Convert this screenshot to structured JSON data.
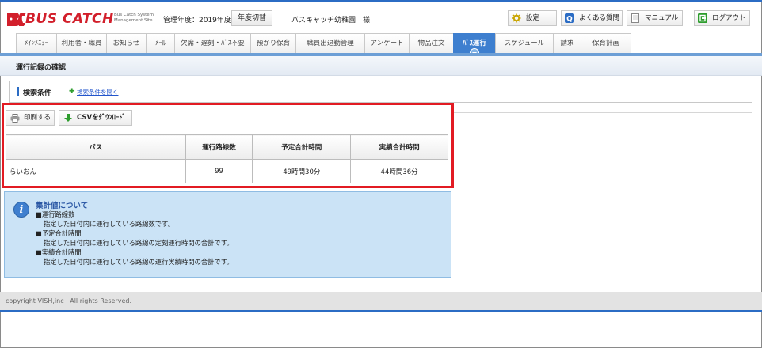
{
  "header": {
    "logo_text": "BUS CATCH",
    "logo_subtitle_1": "Bus Catch System",
    "logo_subtitle_2": "Management Site",
    "fiscal_year": "管理年度：2019年度",
    "year_switch_label": "年度切替",
    "organization": "バスキャッチ幼稚園　様",
    "buttons": {
      "settings": "設定",
      "faq": "よくある質問",
      "manual": "マニュアル",
      "logout": "ログアウト"
    }
  },
  "nav": {
    "tabs": [
      {
        "label": "ﾒｲﾝﾒﾆｭｰ"
      },
      {
        "label": "利用者・職員"
      },
      {
        "label": "お知らせ"
      },
      {
        "label": "ﾒｰﾙ"
      },
      {
        "label": "欠席・遅刻・ﾊﾞｽ不要"
      },
      {
        "label": "預かり保育"
      },
      {
        "label": "職員出退勤管理"
      },
      {
        "label": "アンケート"
      },
      {
        "label": "物品注文"
      },
      {
        "label": "ﾊﾞｽ運行"
      },
      {
        "label": "スケジュール"
      },
      {
        "label": "請求"
      },
      {
        "label": "保育計画"
      }
    ],
    "active_tab": "ﾊﾞｽ運行"
  },
  "page": {
    "title": "運行記録の確認",
    "search": {
      "label": "検索条件",
      "open_link": "検索条件を開く"
    },
    "toolbar": {
      "print_label": "印刷する",
      "csv_label": "CSVをﾀﾞｳﾝﾛｰﾄﾞ"
    },
    "table": {
      "headers": [
        "バス",
        "運行路線数",
        "予定合計時間",
        "実績合計時間"
      ],
      "rows": [
        [
          "らいおん",
          "99",
          "49時間30分",
          "44時間36分"
        ]
      ]
    },
    "info": {
      "title": "集計値について",
      "lines": [
        "■運行路線数",
        "指定した日付内に運行している路線数です。",
        "■予定合計時間",
        "指定した日付内に運行している路線の定刻運行時間の合計です。",
        "■実績合計時間",
        "指定した日付内に運行している路線の運行実績時間の合計です。"
      ]
    }
  },
  "footer": {
    "copyright": "copyright VISH,inc . All rights Reserved."
  },
  "colors": {
    "brand_red": "#d21f2b",
    "accent_blue": "#3e7fcf",
    "highlight_red": "#e21b23",
    "info_bg": "#cbe3f6"
  }
}
